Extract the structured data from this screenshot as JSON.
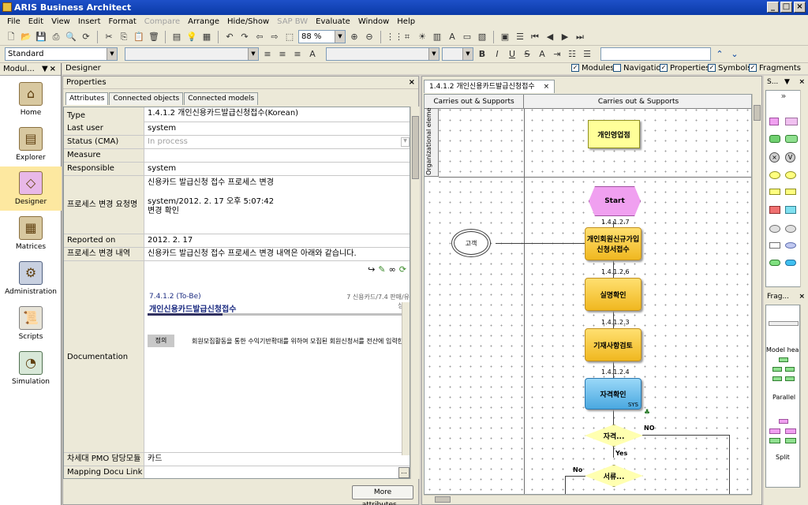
{
  "app_title": "ARIS Business Architect",
  "menu": [
    "File",
    "Edit",
    "View",
    "Insert",
    "Format",
    "Compare",
    "Arrange",
    "Hide/Show",
    "SAP BW",
    "Evaluate",
    "Window",
    "Help"
  ],
  "menu_disabled": [
    "Compare",
    "SAP BW"
  ],
  "toolbar": {
    "zoom": "88 %",
    "style": "Standard"
  },
  "left_panel": {
    "title": "Modul...",
    "items": [
      {
        "label": "Home",
        "icon": "home-icon"
      },
      {
        "label": "Explorer",
        "icon": "explorer-icon"
      },
      {
        "label": "Designer",
        "icon": "designer-icon",
        "selected": true
      },
      {
        "label": "Matrices",
        "icon": "matrices-icon"
      },
      {
        "label": "Administration",
        "icon": "administration-icon"
      },
      {
        "label": "Scripts",
        "icon": "scripts-icon"
      },
      {
        "label": "Simulation",
        "icon": "simulation-icon"
      }
    ]
  },
  "designer": {
    "title": "Designer",
    "checks": [
      {
        "label": "Modules",
        "checked": true
      },
      {
        "label": "Navigation",
        "checked": false
      },
      {
        "label": "Properties",
        "checked": true
      },
      {
        "label": "Symbols",
        "checked": true
      },
      {
        "label": "Fragments",
        "checked": true
      }
    ]
  },
  "properties": {
    "title": "Properties",
    "tabs": [
      "Attributes",
      "Connected objects",
      "Connected models"
    ],
    "rows": [
      {
        "key": "Type",
        "value": "1.4.1.2  개인신용카드발급신청접수(Korean)"
      },
      {
        "key": "Last user",
        "value": "system"
      },
      {
        "key": "Status (CMA)",
        "value": "In process"
      },
      {
        "key": "Measure",
        "value": ""
      },
      {
        "key": "Responsible",
        "value": "system"
      },
      {
        "key": "프로세스 변경 요청명",
        "value_lines": [
          "신용카드 발급신청 접수 프로세스 변경",
          "",
          "system/2012. 2. 17 오후 5:07:42",
          "변경 확인"
        ]
      },
      {
        "key": "Reported on",
        "value": "2012. 2. 17"
      },
      {
        "key": "프로세스 변경 내역",
        "value": "신용카드 발급신청 접수 프로세스 변경 내역은 아래와 같습니다."
      },
      {
        "key": "Documentation",
        "doc": {
          "code": "7.4.1.2 (To-Be)",
          "title": "개인신용카드발급신청접수",
          "right1": "7 신용카드/7.4 판매/유",
          "right2": "상품",
          "def_label": "정의",
          "def_text": "회원모집활동을 통한 수익기반확대를 위하여 모집된 회원신청서를 전산에 입력한"
        }
      },
      {
        "key": "차세대 PMO 담당모듈",
        "value": "카드"
      },
      {
        "key": "Mapping Docu Link",
        "value": ""
      }
    ],
    "more_button": "More attributes..."
  },
  "canvas": {
    "tab": "1.4.1.2  개인신용카드발급신청접수",
    "lane_left": "Carries out & Supports",
    "lane_right": "Carries out & Supports",
    "vlane": "Organizational eleme",
    "nodes": {
      "org_unit": "개인영업점",
      "start": "Start",
      "customer": "고객",
      "f1": "개인회원신규가입신청서접수",
      "f2": "실명확인",
      "f3": "기재사항검토",
      "f4": "자격확인",
      "f4_tag": "SYS",
      "d1": "자격...",
      "d2": "서류..."
    },
    "edge_labels": [
      "1.4.1.2.7",
      "1.4.1.2.6",
      "1.4.1.2.3",
      "1.4.1.2.4"
    ],
    "branch": {
      "no": "NO",
      "yes": "Yes",
      "no2": "No"
    }
  },
  "right_panels": {
    "symbols_title": "S...",
    "fragments_title": "Frag...",
    "fragments": [
      "Model head",
      "Parallel",
      "Split"
    ]
  }
}
